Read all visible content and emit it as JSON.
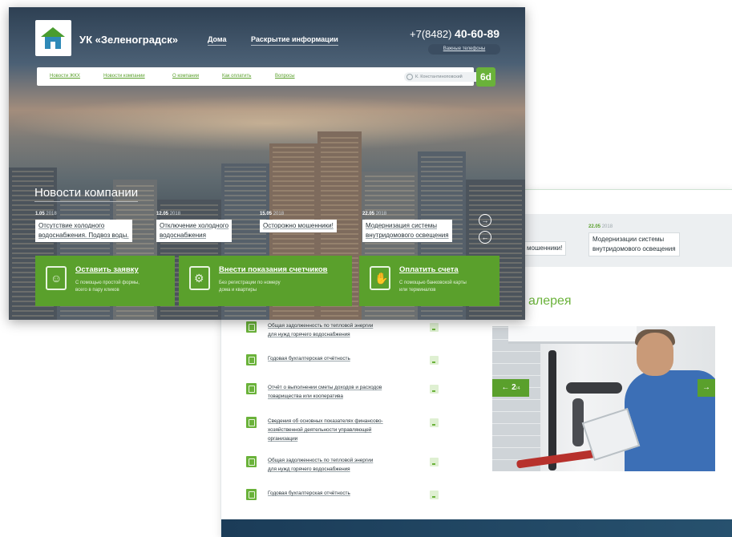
{
  "colors": {
    "accent": "#5aa02c",
    "accent_light": "#6ab23a",
    "dark": "#263238"
  },
  "header": {
    "company": "УК «Зеленоградск»",
    "nav": [
      "Дома",
      "Раскрытие информации"
    ],
    "phone_prefix": "+7(8482)",
    "phone_number": "40-60-89",
    "phone_button": "Важные телефоны"
  },
  "menu": {
    "items": [
      "Новости ЖКХ",
      "Новости компании",
      "О компании",
      "Как оплатить",
      "Вопросы"
    ],
    "address": "К. Константиноповский",
    "eye_button": "6d",
    "eye_icon": "glasses-icon"
  },
  "news": {
    "title": "Новости компании",
    "items": [
      {
        "day": "1.05",
        "year": "2018",
        "title_1": "Отсутствие холодного",
        "title_2": "водоснабжения. Подвоз воды."
      },
      {
        "day": "12.05",
        "year": "2018",
        "title_1": "Отключение холодного",
        "title_2": "водоснабжения"
      },
      {
        "day": "15.05",
        "year": "2018",
        "title_1": "Осторожно мошенники!",
        "title_2": ""
      },
      {
        "day": "22.05",
        "year": "2018",
        "title_1": "Модернизация системы",
        "title_2": "внутридомового освещения"
      }
    ],
    "next_icon": "→",
    "prev_icon": "←"
  },
  "actions": [
    {
      "title": "Оставить заявку",
      "desc_1": "С помощью простой формы,",
      "desc_2": "всего в пару кликов",
      "icon": "worker-icon",
      "glyph": "☺"
    },
    {
      "title": "Внести показания счетчиков",
      "desc_1": "Без регистрации по номеру",
      "desc_2": "дома и квартиры",
      "icon": "meter-icon",
      "glyph": "⚙"
    },
    {
      "title": "Оплатить счета",
      "desc_1": "С помощью банковской карты",
      "desc_2": "или терминалов",
      "icon": "payment-icon",
      "glyph": "✋"
    }
  ],
  "back_news": [
    {
      "title_1": "мошенники!",
      "title_2": ""
    },
    {
      "day": "22.05",
      "year": "2018",
      "title_1": "Модернизации системы",
      "title_2": "внутридомового освещения"
    }
  ],
  "gallery": {
    "title": "алерея",
    "current": "2",
    "total": "/4",
    "prev_icon": "←",
    "next_icon": "→"
  },
  "documents": [
    {
      "line_1": "Общая задолженность по тепловой энергии",
      "line_2": "для нужд горячего водоснабжения",
      "line_3": ""
    },
    {
      "line_1": "Годовая бухгалтерская отчётность",
      "line_2": "",
      "line_3": ""
    },
    {
      "line_1": "Отчёт о выполнении сметы доходов и расходов",
      "line_2": "товарищества или кооператива",
      "line_3": ""
    },
    {
      "line_1": "Сведения об основных показателях финансово-",
      "line_2": "хозяйственной деятельности управляющей",
      "line_3": "организации"
    },
    {
      "line_1": "Общая задолженность по тепловой энергии",
      "line_2": "для нужд горячего водоснабжения",
      "line_3": ""
    },
    {
      "line_1": "Годовая бухгалтерская отчётность",
      "line_2": "",
      "line_3": ""
    }
  ]
}
